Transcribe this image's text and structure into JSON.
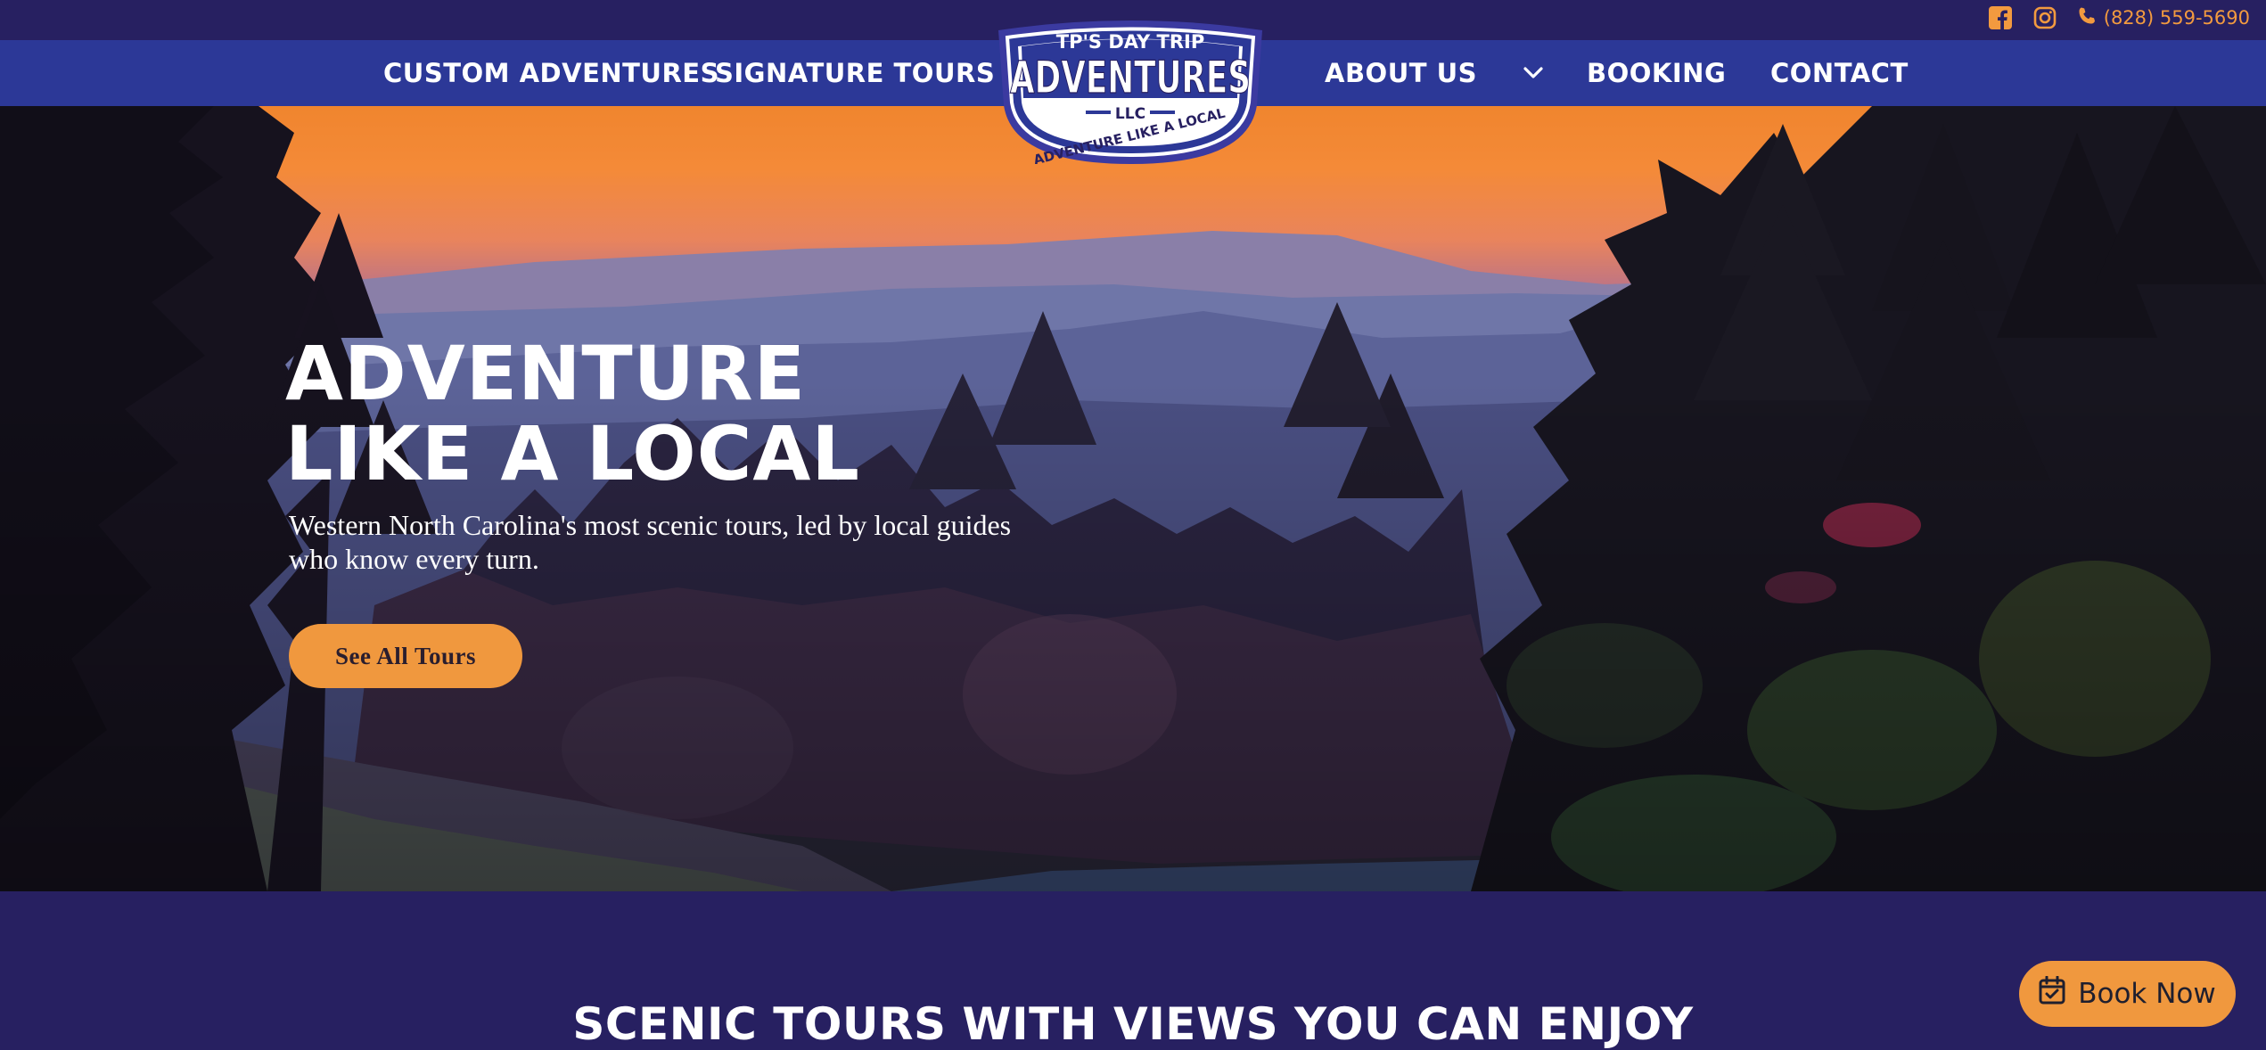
{
  "topbar": {
    "icons": [
      "facebook-icon",
      "instagram-icon",
      "phone-icon"
    ],
    "phone": "(828) 559-5690"
  },
  "nav": {
    "left": [
      "CUSTOM ADVENTURES",
      "SIGNATURE TOURS"
    ],
    "right": [
      "ABOUT US",
      "BOOKING",
      "CONTACT"
    ],
    "dropdown_icon": "chevron-down-icon"
  },
  "logo": {
    "top": "TP'S DAY TRIP",
    "main": "ADVENTURES",
    "llc": "LLC",
    "tagline": "ADVENTURE LIKE A LOCAL"
  },
  "hero": {
    "title": "ADVENTURE LIKE A LOCAL",
    "subtitle": "Western North Carolina's most scenic tours, led by local guides who know every turn.",
    "button": "See All Tours"
  },
  "section": {
    "title": "SCENIC TOURS WITH VIEWS YOU CAN ENJOY"
  },
  "floating": {
    "book_now": "Book Now",
    "icon": "calendar-check-icon"
  },
  "colors": {
    "navy": "#272061",
    "nav_blue": "#2c3897",
    "accent_orange": "#f0983e",
    "white": "#ffffff"
  }
}
